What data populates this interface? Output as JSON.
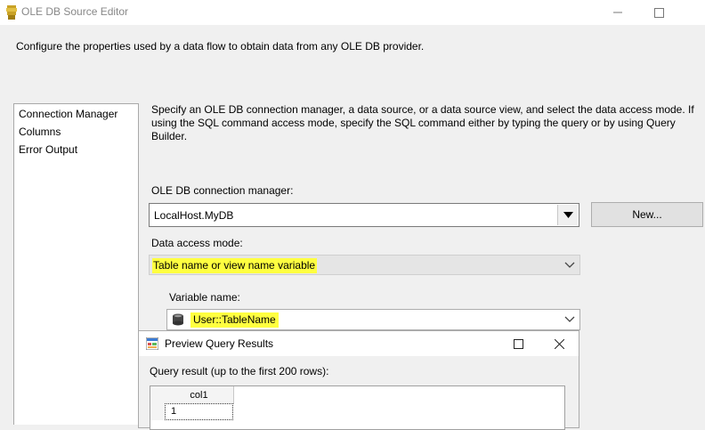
{
  "window": {
    "title": "OLE DB Source Editor",
    "description": "Configure the properties used by a data flow to obtain data from any OLE DB provider."
  },
  "nav": {
    "items": [
      {
        "label": "Connection Manager"
      },
      {
        "label": "Columns"
      },
      {
        "label": "Error Output"
      }
    ]
  },
  "main": {
    "instructions": "Specify an OLE DB connection manager, a data source, or a data source view, and select the data access mode. If using the SQL command access mode, specify the SQL command either by typing the query or by using Query Builder.",
    "connection_label": "OLE DB connection manager:",
    "connection_value": "LocalHost.MyDB",
    "new_button": "New...",
    "access_mode_label": "Data access mode:",
    "access_mode_value": "Table name or view name variable",
    "variable_label": "Variable name:",
    "variable_value": "User::TableName"
  },
  "preview": {
    "title": "Preview Query Results",
    "result_label": "Query result (up to the first 200 rows):",
    "columns": [
      "col1"
    ],
    "rows": [
      [
        "1"
      ]
    ]
  },
  "colors": {
    "highlight": "#ffff40",
    "titlebar": "#ffffff",
    "dialog_bg": "#f0f0f0"
  }
}
